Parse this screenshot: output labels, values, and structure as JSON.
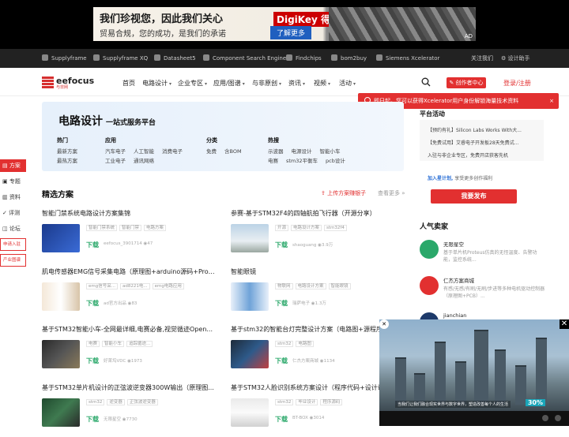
{
  "top_ad": {
    "headline": "我们珍视您，因此我们关心",
    "subline": "贸易合规，您的成功，是我们的承诺",
    "brand": "DigiKey 得捷",
    "cta": "了解更多",
    "ad_label": "AD"
  },
  "partners": [
    "Supplyframe",
    "Supplyframe XQ",
    "Datasheet5",
    "Component Search Engine",
    "Findchips",
    "bom2buy",
    "Siemens Xcelerator"
  ],
  "partner_right": {
    "follow": "关注我们",
    "design_helper": "设计助手"
  },
  "logo": {
    "name": "eefocus",
    "sub": "与非网"
  },
  "nav": {
    "items": [
      "首页",
      "电路设计",
      "企业专区",
      "应用/图谱",
      "与非原创",
      "资讯",
      "视频",
      "活动"
    ],
    "creator": "创作者中心",
    "login": "登录/注册"
  },
  "notice": {
    "text": "即日起，您可以获得Xcelerator用户身份解锁海量技术资料",
    "close": "×"
  },
  "hero": {
    "title": "电路设计",
    "subtitle": "一站式服务平台",
    "columns": [
      {
        "head": "热门",
        "rows": [
          [
            "最新方案"
          ],
          [
            "最热方案"
          ]
        ]
      },
      {
        "head": "应用",
        "rows": [
          [
            "汽车电子",
            "人工智能",
            "消费电子"
          ],
          [
            "工业电子",
            "通讯网络"
          ]
        ]
      },
      {
        "head": "分类",
        "rows": [
          [
            "免费",
            "含BOM"
          ]
        ]
      },
      {
        "head": "热搜",
        "rows": [
          [
            "示波器",
            "电源设计",
            "智能小车"
          ],
          [
            "电赛",
            "stm32平衡车",
            "pcb设计"
          ]
        ]
      }
    ]
  },
  "side": {
    "items": [
      "方案",
      "专题",
      "资料",
      "评测",
      "论坛"
    ],
    "join": "申请入驻",
    "map": "产业图谱"
  },
  "section": {
    "title": "精选方案",
    "upload": "上传方案赚银子",
    "more": "查看更多 »"
  },
  "cards": [
    {
      "title": "智能门禁系统电路设计方案集锦",
      "tags": [
        "智能门禁系统",
        "智能门禁",
        "电路方案"
      ],
      "download": "下载",
      "author": "eefocus_3901714",
      "views": "47"
    },
    {
      "title": "参赛-基于STM32F4的四轴航拍飞行器（开源分享）",
      "tags": [
        "开源",
        "电路设计方案",
        "stm32f4"
      ],
      "download": "下载",
      "author": "shaoguang",
      "views": "3.9万"
    },
    {
      "title": "肌电传感器EMG信号采集电路（原理图+arduino源码+Proc...",
      "tags": [
        "emg信号采...",
        "ad8221电...",
        "emg电路应用"
      ],
      "download": "下载",
      "author": "ad官方出品",
      "views": "83"
    },
    {
      "title": "智能眼镜",
      "tags": [
        "物联网",
        "电路设计方案",
        "智能眼镜"
      ],
      "download": "下载",
      "author": "瑞萨电子",
      "views": "1.3万"
    },
    {
      "title": "基于STM32智能小车-全网最详细,电赛必备,视觉循迹Open...",
      "tags": [
        "电赛",
        "智能小车",
        "追踪循迹..."
      ],
      "download": "下载",
      "author": "好莱坞VDC",
      "views": "1973"
    },
    {
      "title": "基于stm32的智能台灯完整设计方案（电路图+源程序...",
      "tags": [
        "stm32",
        "电路图"
      ],
      "download": "下载",
      "author": "仁杰方案商城",
      "views": "1134"
    },
    {
      "title": "基于STM32单片机设计的正弦波逆变器300W输出（原理图...",
      "tags": [
        "stm32",
        "逆变器",
        "正弦波逆变器"
      ],
      "download": "下载",
      "author": "无限星空",
      "views": "7730"
    },
    {
      "title": "基于STM32人脸识别系统方案设计（程序代码+设计说...",
      "tags": [
        "stm32",
        "毕业设计",
        "程序源码"
      ],
      "download": "下载",
      "author": "BT-BOX",
      "views": "3014"
    }
  ],
  "platform": {
    "title": "平台活动",
    "items": [
      "【预约有礼】Silicon Labs Works With大...",
      "【免费试用】艾睿电子开发板28天免费试...",
      "入驻与非企业专区，免费开店获客先机"
    ],
    "join_plan": "加入星计划,",
    "join_plan_rest": "享受更多创作福利",
    "publish": "我要发布"
  },
  "sellers": {
    "title": "人气卖家",
    "items": [
      {
        "name": "无限星空",
        "desc": "基于单片机Proteus仿真的无怪温度、告警功能，监控系统..."
      },
      {
        "name": "仁杰方案商城",
        "desc": "有感/无感/有刷/无刷/步进等多种电机驱动控制器（原理图+PCB）..."
      },
      {
        "name": "jianchian",
        "desc": ""
      }
    ]
  },
  "video": {
    "caption": "当我们让我们融合现实世界与数字世界，塑造改善每个人的生活",
    "percent": "30%"
  },
  "colors": {
    "accent": "#e23030",
    "download": "#2aa86a",
    "link": "#2a6fd6"
  }
}
